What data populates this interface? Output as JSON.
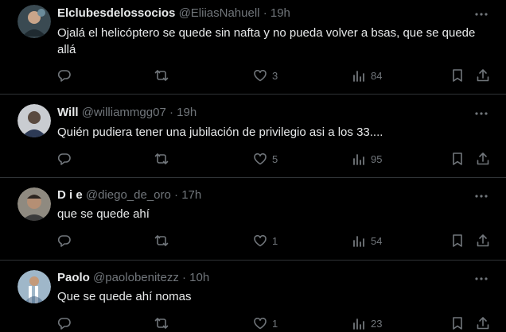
{
  "colors": {
    "background": "#000000",
    "text": "#e7e9ea",
    "muted": "#71767b",
    "divider": "#2f3336"
  },
  "icons": {
    "reply": "reply-icon",
    "retweet": "retweet-icon",
    "like": "heart-icon",
    "views": "views-icon",
    "bookmark": "bookmark-icon",
    "share": "share-icon",
    "more": "more-icon"
  },
  "tweets": [
    {
      "name": "Elclubesdelossocios",
      "handle": "@EliiasNahuell",
      "sep": "·",
      "time": "19h",
      "text": "Ojalá el helicóptero se quede sin nafta y no pueda volver a bsas, que se quede allá",
      "likes": "3",
      "views": "84"
    },
    {
      "name": "Will",
      "handle": "@williammgg07",
      "sep": "·",
      "time": "19h",
      "text": "Quién pudiera tener una jubilación de privilegio asi a los 33....",
      "likes": "5",
      "views": "95"
    },
    {
      "name": "D i e",
      "handle": "@diego_de_oro",
      "sep": "·",
      "time": "17h",
      "text": "que se quede ahí",
      "likes": "1",
      "views": "54"
    },
    {
      "name": "Paolo",
      "handle": "@paolobenitezz",
      "sep": "·",
      "time": "10h",
      "text": "Que se quede ahí nomas",
      "likes": "1",
      "views": "23"
    }
  ]
}
